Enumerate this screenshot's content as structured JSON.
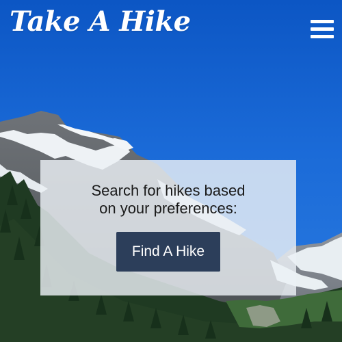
{
  "header": {
    "logo_text": "Take A Hike",
    "menu_icon": "hamburger-menu-icon"
  },
  "search": {
    "prompt_line1": "Search for hikes based",
    "prompt_line2": "on your preferences:",
    "button_label": "Find A Hike"
  },
  "colors": {
    "sky": "#0c56c4",
    "button": "#2c3e5a",
    "card": "#ecf0f5"
  }
}
